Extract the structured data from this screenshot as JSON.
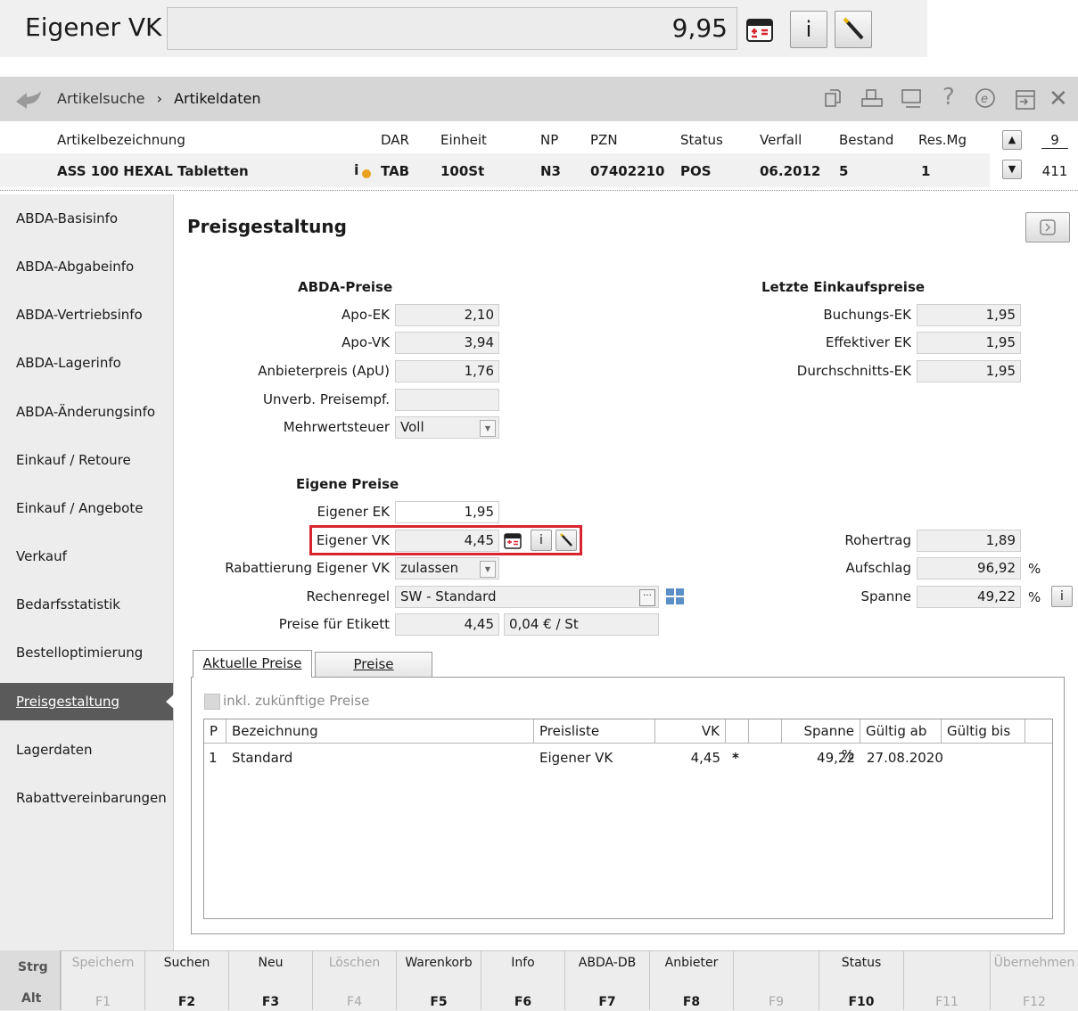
{
  "top_bar": {
    "label": "Eigener VK",
    "value": "9,95"
  },
  "breadcrumb": {
    "back": "",
    "item1": "Artikelsuche",
    "sep": "›",
    "item2": "Artikeldaten"
  },
  "toolbar_icons": [
    "copy-icon",
    "print-icon",
    "monitor-icon",
    "help-icon",
    "e-icon",
    "export-icon",
    "close-icon"
  ],
  "article_header": {
    "columns": [
      "Artikelbezeichnung",
      "DAR",
      "Einheit",
      "NP",
      "PZN",
      "Status",
      "Verfall",
      "Bestand",
      "Res.Mg"
    ],
    "values": [
      "ASS 100 HEXAL Tabletten",
      "TAB",
      "100St",
      "N3",
      "07402210",
      "POS",
      "06.2012",
      "5",
      "1"
    ],
    "counter_top": "9",
    "counter_bottom": "411"
  },
  "sidebar": {
    "items": [
      {
        "label": "ABDA-Basisinfo"
      },
      {
        "label": "ABDA-Abgabeinfo"
      },
      {
        "label": "ABDA-Vertriebsinfo"
      },
      {
        "label": "ABDA-Lagerinfo"
      },
      {
        "label": "ABDA-Änderungsinfo"
      },
      {
        "label": "Einkauf / Retoure"
      },
      {
        "label": "Einkauf / Angebote"
      },
      {
        "label": "Verkauf"
      },
      {
        "label": "Bedarfsstatistik"
      },
      {
        "label": "Bestelloptimierung"
      },
      {
        "label": "Preisgestaltung"
      },
      {
        "label": "Lagerdaten"
      },
      {
        "label": "Rabattvereinbarungen"
      }
    ]
  },
  "main": {
    "title": "Preisgestaltung",
    "abda": {
      "heading": "ABDA-Preise",
      "apo_ek_label": "Apo-EK",
      "apo_ek": "2,10",
      "apo_vk_label": "Apo-VK",
      "apo_vk": "3,94",
      "apu_label": "Anbieterpreis (ApU)",
      "apu": "1,76",
      "uvp_label": "Unverb. Preisempf.",
      "uvp": "",
      "mwst_label": "Mehrwertsteuer",
      "mwst": "Voll"
    },
    "letzte": {
      "heading": "Letzte Einkaufspreise",
      "buchungs_label": "Buchungs-EK",
      "buchungs": "1,95",
      "effektiv_label": "Effektiver EK",
      "effektiv": "1,95",
      "durchschnitt_label": "Durchschnitts-EK",
      "durchschnitt": "1,95"
    },
    "eigene": {
      "heading": "Eigene Preise",
      "ek_label": "Eigener EK",
      "ek": "1,95",
      "vk_label": "Eigener VK",
      "vk": "4,45",
      "rabatt_label": "Rabattierung Eigener VK",
      "rabatt": "zulassen",
      "regel_label": "Rechenregel",
      "regel": "SW - Standard",
      "etikett_label": "Preise für Etikett",
      "etikett": "4,45",
      "etikett_unit": "0,04 € / St"
    },
    "kennzahlen": {
      "rohertrag_label": "Rohertrag",
      "rohertrag": "1,89",
      "aufschlag_label": "Aufschlag",
      "aufschlag": "96,92",
      "spanne_label": "Spanne",
      "spanne": "49,22",
      "percent": "%"
    },
    "tabs": [
      {
        "label": "Aktuelle Preise"
      },
      {
        "label": "Preise"
      }
    ],
    "checkbox_label": "inkl. zukünftige Preise",
    "table": {
      "headers": [
        "P",
        "Bezeichnung",
        "Preisliste",
        "VK",
        "",
        "Spanne %",
        "Gültig ab",
        "Gültig bis"
      ],
      "rows": [
        [
          "1",
          "Standard",
          "Eigener VK",
          "4,45",
          "*",
          "49,22",
          "27.08.2020",
          ""
        ]
      ]
    }
  },
  "fkeys": {
    "mod1": "Strg",
    "mod2": "Alt",
    "keys": [
      {
        "label": "Speichern",
        "key": "F1"
      },
      {
        "label": "Suchen",
        "key": "F2"
      },
      {
        "label": "Neu",
        "key": "F3"
      },
      {
        "label": "Löschen",
        "key": "F4"
      },
      {
        "label": "Warenkorb",
        "key": "F5"
      },
      {
        "label": "Info",
        "key": "F6"
      },
      {
        "label": "ABDA-DB",
        "key": "F7"
      },
      {
        "label": "Anbieter",
        "key": "F8"
      },
      {
        "label": "",
        "key": "F9"
      },
      {
        "label": "Status",
        "key": "F10"
      },
      {
        "label": "",
        "key": "F11"
      },
      {
        "label": "Übernehmen",
        "key": "F12"
      }
    ]
  },
  "colors": {
    "highlight_red": "#d9232e",
    "sidebar_active": "#5a5a5a",
    "field_bg": "#efefef"
  }
}
